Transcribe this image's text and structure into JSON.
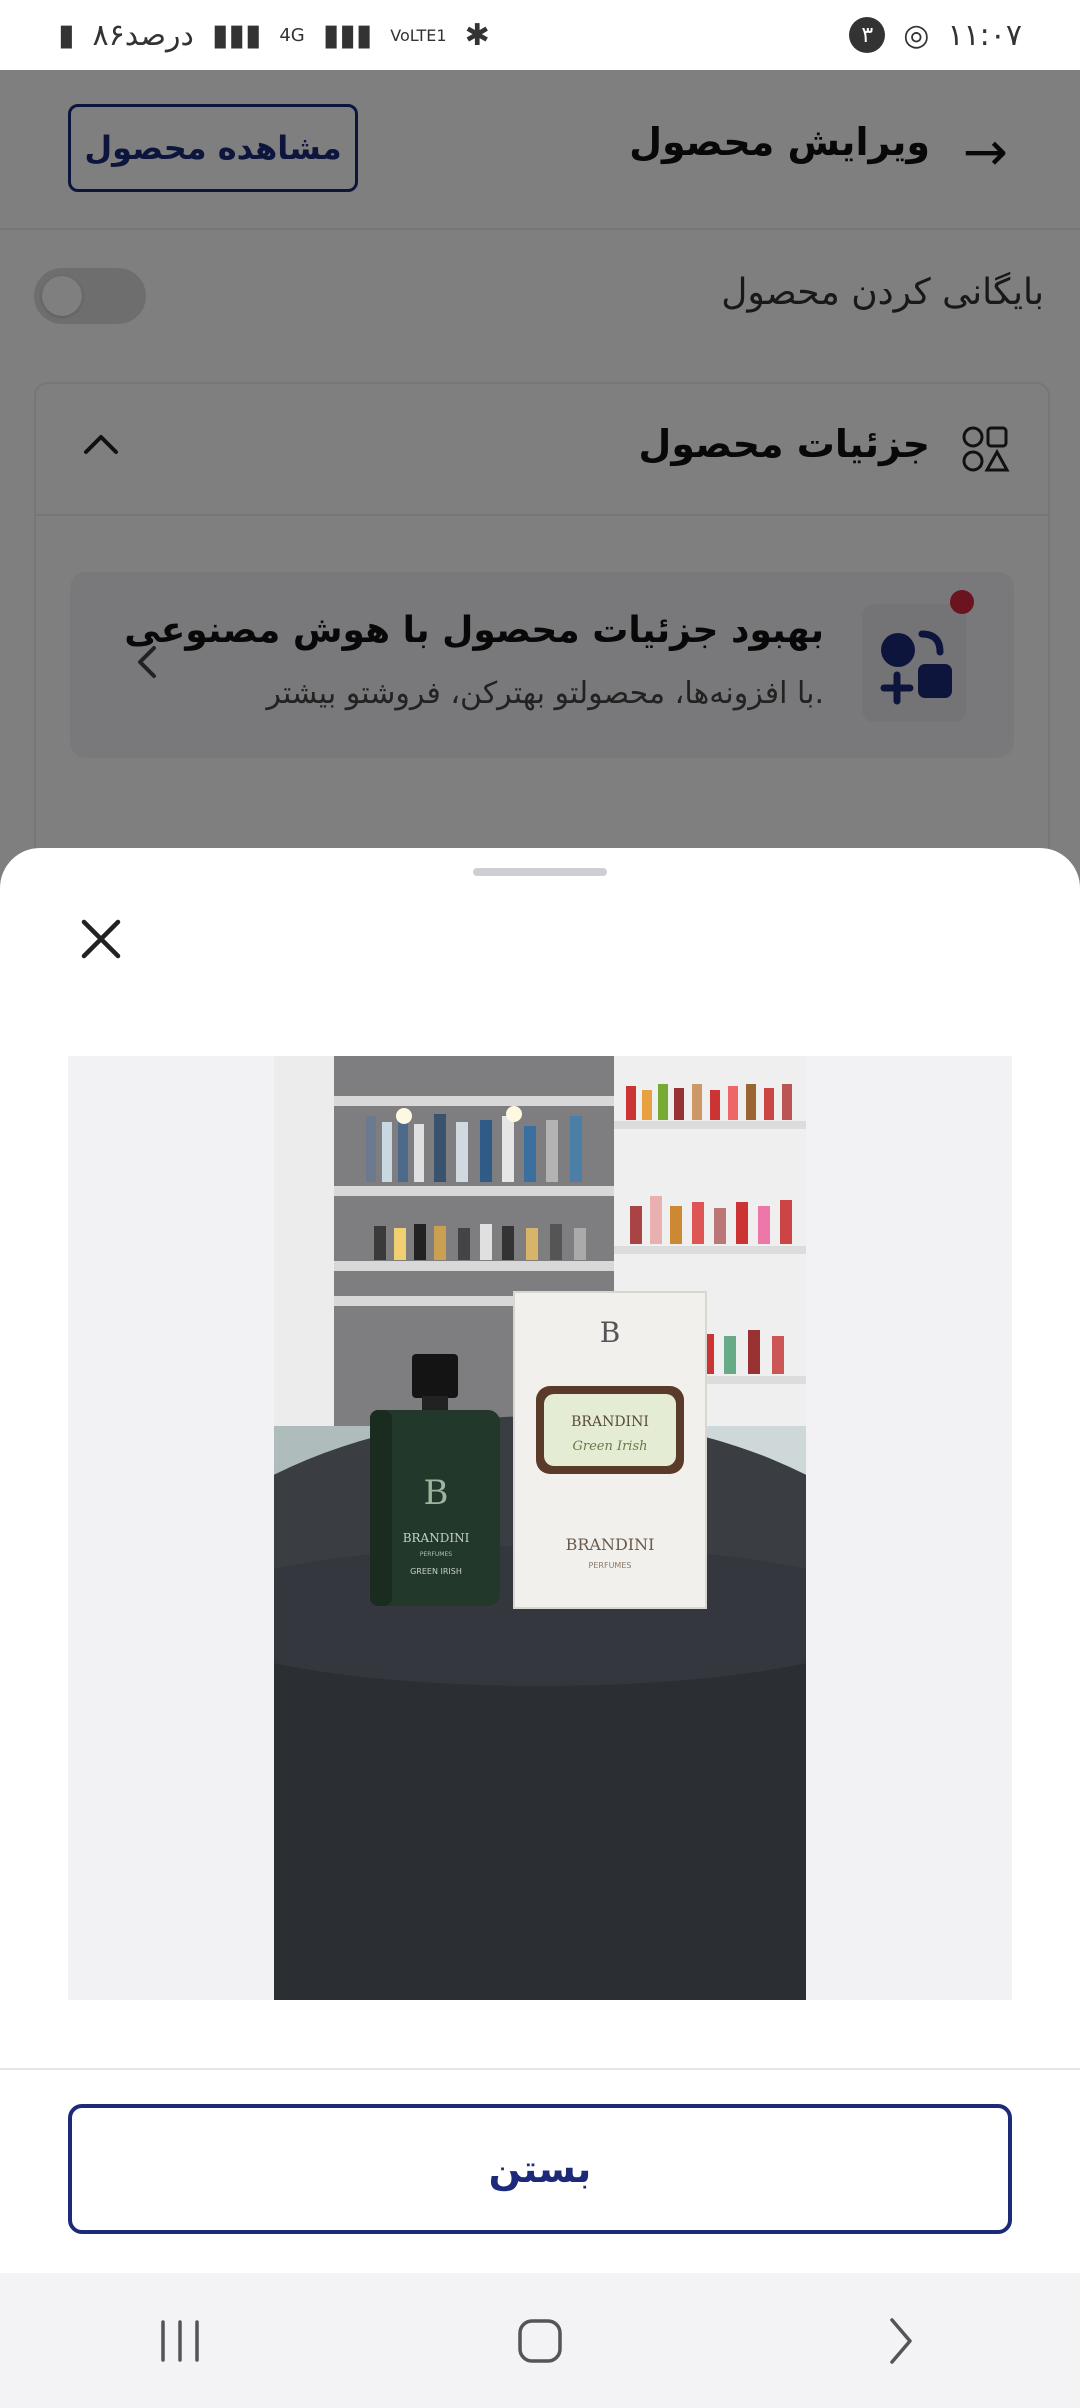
{
  "status_bar": {
    "time": "۱۱:۰۷",
    "notification_count": "۳",
    "battery": "۸۶درصد",
    "network": "4G",
    "volte": "VoLTE1"
  },
  "header": {
    "title": "ویرایش محصول",
    "view_product_label": "مشاهده محصول"
  },
  "archive": {
    "label": "بایگانی کردن محصول",
    "enabled": false
  },
  "details_section": {
    "title": "جزئیات محصول",
    "ai_title": "بهبود جزئیات محصول با هوش مصنوعی",
    "ai_subtitle": "با افزونه‌ها، محصولتو بهترکن، فروشتو بیشتر."
  },
  "sheet": {
    "close_button_label": "بستن"
  },
  "photo": {
    "box_brand": "BRANDINI",
    "box_label": "Green Irish",
    "box_sub": "PERFUMES",
    "bottle_brand": "BRANDINI",
    "bottle_sub": "PERFUMES",
    "bottle_name": "GREEN IRISH",
    "box_logo": "B"
  },
  "colors": {
    "accent": "#1d2a7a",
    "alert_dot": "#d7263d"
  }
}
